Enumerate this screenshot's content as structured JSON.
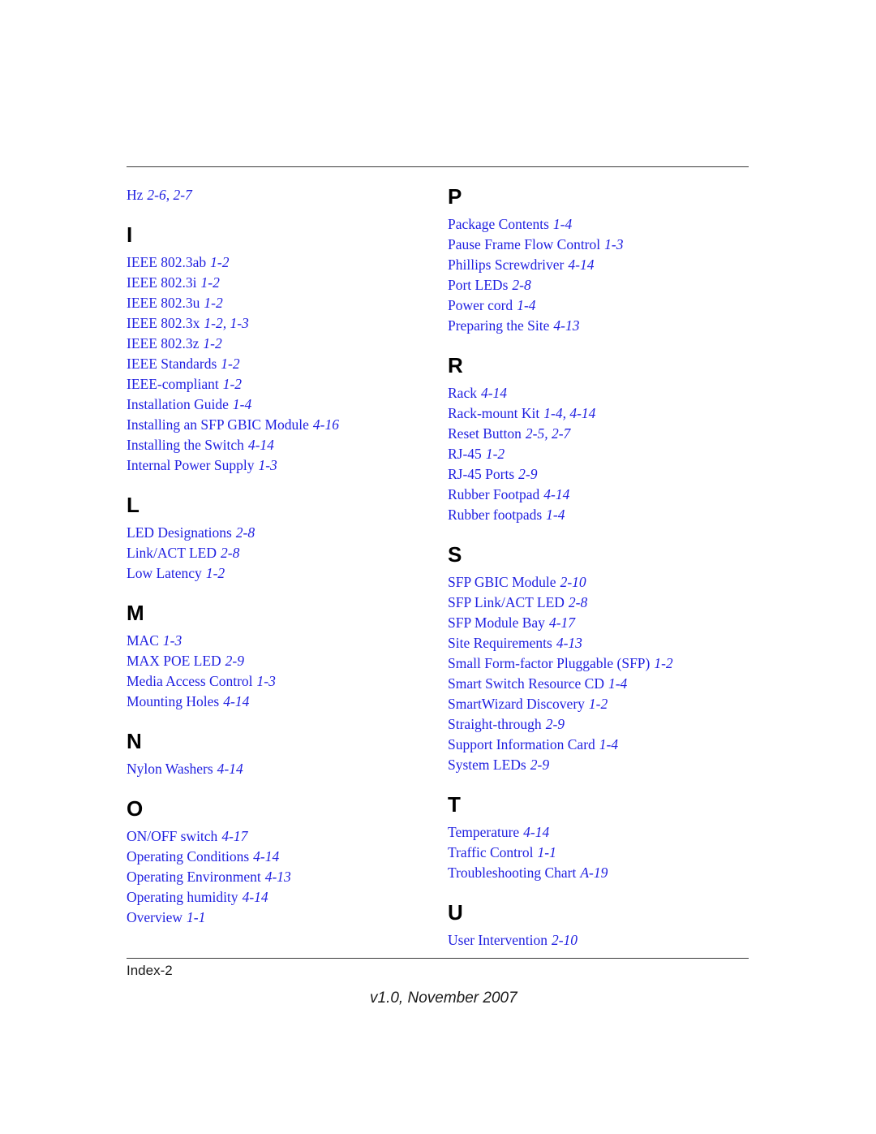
{
  "page": {
    "footer_page_number": "Index-2",
    "footer_version": "v1.0, November 2007",
    "entry_color": "#1f1fe0",
    "rule_color": "#3b3b3b"
  },
  "columns": [
    {
      "name": "left-column",
      "sections": [
        {
          "letter": "",
          "entries": [
            {
              "term": "Hz",
              "pages": "2-6, 2-7"
            }
          ]
        },
        {
          "letter": "I",
          "entries": [
            {
              "term": "IEEE 802.3ab",
              "pages": "1-2"
            },
            {
              "term": "IEEE 802.3i",
              "pages": "1-2"
            },
            {
              "term": "IEEE 802.3u",
              "pages": "1-2"
            },
            {
              "term": "IEEE 802.3x",
              "pages": "1-2, 1-3"
            },
            {
              "term": "IEEE 802.3z",
              "pages": "1-2"
            },
            {
              "term": "IEEE Standards",
              "pages": "1-2"
            },
            {
              "term": "IEEE-compliant",
              "pages": "1-2"
            },
            {
              "term": "Installation Guide",
              "pages": "1-4"
            },
            {
              "term": "Installing an SFP GBIC Module",
              "pages": "4-16"
            },
            {
              "term": "Installing the Switch",
              "pages": "4-14"
            },
            {
              "term": "Internal Power Supply",
              "pages": "1-3"
            }
          ]
        },
        {
          "letter": "L",
          "entries": [
            {
              "term": "LED Designations",
              "pages": "2-8"
            },
            {
              "term": "Link/ACT LED",
              "pages": "2-8"
            },
            {
              "term": "Low Latency",
              "pages": "1-2"
            }
          ]
        },
        {
          "letter": "M",
          "entries": [
            {
              "term": "MAC",
              "pages": "1-3"
            },
            {
              "term": "MAX POE LED",
              "pages": "2-9"
            },
            {
              "term": "Media Access Control",
              "pages": "1-3"
            },
            {
              "term": "Mounting Holes",
              "pages": "4-14"
            }
          ]
        },
        {
          "letter": "N",
          "entries": [
            {
              "term": "Nylon Washers",
              "pages": "4-14"
            }
          ]
        },
        {
          "letter": "O",
          "entries": [
            {
              "term": "ON/OFF switch",
              "pages": "4-17"
            },
            {
              "term": "Operating Conditions",
              "pages": "4-14"
            },
            {
              "term": "Operating Environment",
              "pages": "4-13"
            },
            {
              "term": "Operating humidity",
              "pages": "4-14"
            },
            {
              "term": "Overview",
              "pages": "1-1"
            }
          ]
        }
      ]
    },
    {
      "name": "right-column",
      "sections": [
        {
          "letter": "P",
          "entries": [
            {
              "term": "Package Contents",
              "pages": "1-4"
            },
            {
              "term": "Pause Frame Flow Control",
              "pages": "1-3"
            },
            {
              "term": "Phillips Screwdriver",
              "pages": "4-14"
            },
            {
              "term": "Port LEDs",
              "pages": "2-8"
            },
            {
              "term": "Power cord",
              "pages": "1-4"
            },
            {
              "term": "Preparing the Site",
              "pages": "4-13"
            }
          ]
        },
        {
          "letter": "R",
          "entries": [
            {
              "term": "Rack",
              "pages": "4-14"
            },
            {
              "term": "Rack-mount Kit",
              "pages": "1-4, 4-14"
            },
            {
              "term": "Reset Button",
              "pages": "2-5, 2-7"
            },
            {
              "term": "RJ-45",
              "pages": "1-2"
            },
            {
              "term": "RJ-45 Ports",
              "pages": "2-9"
            },
            {
              "term": "Rubber Footpad",
              "pages": "4-14"
            },
            {
              "term": "Rubber footpads",
              "pages": "1-4"
            }
          ]
        },
        {
          "letter": "S",
          "entries": [
            {
              "term": "SFP GBIC Module",
              "pages": "2-10"
            },
            {
              "term": "SFP Link/ACT LED",
              "pages": "2-8"
            },
            {
              "term": "SFP Module Bay",
              "pages": "4-17"
            },
            {
              "term": "Site Requirements",
              "pages": "4-13"
            },
            {
              "term": "Small Form-factor Pluggable (SFP)",
              "pages": "1-2"
            },
            {
              "term": "Smart Switch Resource CD",
              "pages": "1-4"
            },
            {
              "term": "SmartWizard Discovery",
              "pages": "1-2"
            },
            {
              "term": "Straight-through",
              "pages": "2-9"
            },
            {
              "term": "Support Information Card",
              "pages": "1-4"
            },
            {
              "term": "System LEDs",
              "pages": "2-9"
            }
          ]
        },
        {
          "letter": "T",
          "entries": [
            {
              "term": "Temperature",
              "pages": "4-14"
            },
            {
              "term": "Traffic Control",
              "pages": "1-1"
            },
            {
              "term": "Troubleshooting Chart",
              "pages": "A-19"
            }
          ]
        },
        {
          "letter": "U",
          "entries": [
            {
              "term": "User Intervention",
              "pages": "2-10"
            }
          ]
        }
      ]
    }
  ]
}
